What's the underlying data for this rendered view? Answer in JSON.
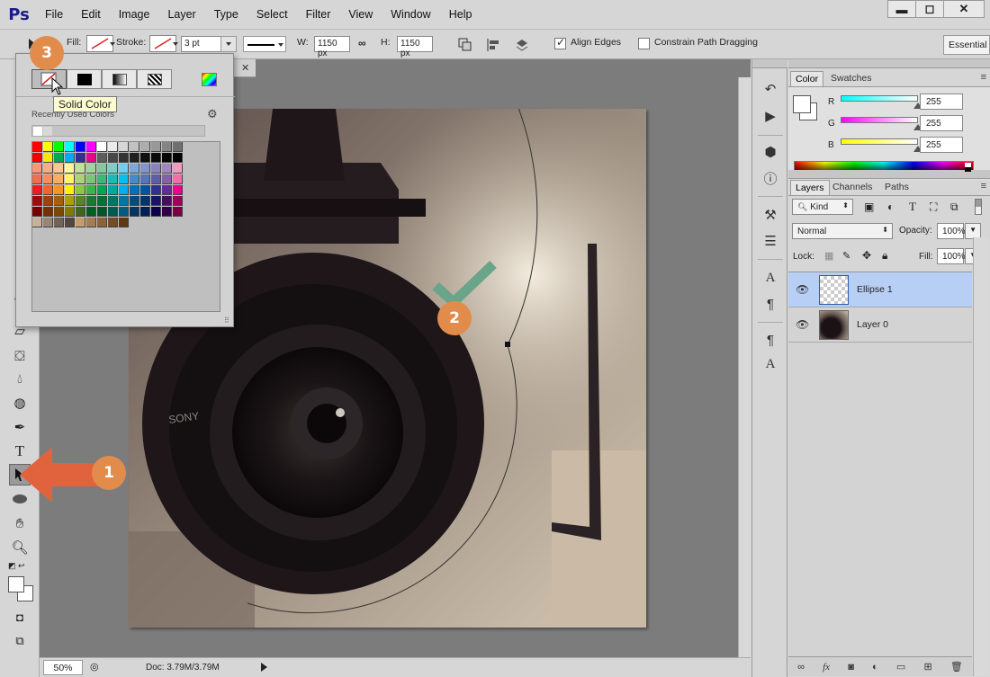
{
  "app": {
    "logo": "Ps"
  },
  "menu": [
    "File",
    "Edit",
    "Image",
    "Layer",
    "Type",
    "Select",
    "Filter",
    "View",
    "Window",
    "Help"
  ],
  "window_controls": {
    "minimize": "▬",
    "maximize": "◻",
    "close": "✕"
  },
  "options": {
    "fill_label": "Fill:",
    "stroke_label": "Stroke:",
    "stroke_width": "3 pt",
    "w_label": "W:",
    "w_value": "1150 px",
    "h_label": "H:",
    "h_value": "1150 px",
    "align_edges": "Align Edges",
    "align_edges_checked": true,
    "constrain": "Constrain Path Dragging",
    "constrain_checked": false,
    "workspace": "Essential"
  },
  "popup": {
    "tooltip": "Solid Color",
    "recent_label": "Recently Used Colors",
    "swatch_rows": [
      [
        "#ff0000",
        "#ffff00",
        "#00ff00",
        "#00ffff",
        "#0000ff",
        "#ff00ff",
        "#ffffff",
        "#ebebeb",
        "#d6d6d6",
        "#c2c2c2",
        "#adadad",
        "#999999",
        "#858585",
        "#707070"
      ],
      [
        "#f20000",
        "#f7ec00",
        "#00a651",
        "#00aeef",
        "#2e3192",
        "#ec008c",
        "#5c5c5c",
        "#474747",
        "#333333",
        "#1f1f1f",
        "#0f0f0f",
        "#0a0a0a",
        "#050505",
        "#000000"
      ],
      [
        "#f7977a",
        "#f9ad81",
        "#fdc68a",
        "#fff79a",
        "#c4df9b",
        "#a2d39c",
        "#82ca9d",
        "#7bcdc8",
        "#6ecff6",
        "#7ea7d8",
        "#8493ca",
        "#8882be",
        "#a187be",
        "#f49ac2"
      ],
      [
        "#f26c4f",
        "#f68e55",
        "#fbaf5c",
        "#fff467",
        "#acd372",
        "#7cc576",
        "#3bb878",
        "#1abbb4",
        "#00bff3",
        "#438ccb",
        "#5574b9",
        "#605ca8",
        "#855fa8",
        "#f06ea9"
      ],
      [
        "#ed1c24",
        "#f26522",
        "#f7941d",
        "#fff200",
        "#8dc73f",
        "#39b54a",
        "#00a651",
        "#00a99d",
        "#00aeef",
        "#0072bc",
        "#0054a5",
        "#2e3192",
        "#662d91",
        "#ec008c"
      ],
      [
        "#9e0b0f",
        "#a0410d",
        "#a36209",
        "#aba000",
        "#598527",
        "#1a7b30",
        "#007236",
        "#00746b",
        "#0076a3",
        "#004b80",
        "#003471",
        "#1b1464",
        "#440e62",
        "#9e005d"
      ],
      [
        "#790000",
        "#7b2e00",
        "#7d4900",
        "#827b00",
        "#406618",
        "#005e20",
        "#005826",
        "#005952",
        "#005b7f",
        "#003663",
        "#002157",
        "#0d004c",
        "#32004b",
        "#7b0046"
      ],
      [
        "#c7b299",
        "#998675",
        "#736357",
        "#534741",
        "#c69c6d",
        "#a67c52",
        "#8c6239",
        "#754c24",
        "#603913"
      ]
    ]
  },
  "status": {
    "zoom": "50%",
    "doc": "Doc: 3.79M/3.79M"
  },
  "callouts": [
    "1",
    "2",
    "3"
  ],
  "color_panel": {
    "tabs": [
      "Color",
      "Swatches"
    ],
    "sliders": [
      {
        "label": "R",
        "value": "255"
      },
      {
        "label": "G",
        "value": "255"
      },
      {
        "label": "B",
        "value": "255"
      }
    ]
  },
  "layers_panel": {
    "tabs": [
      "Layers",
      "Channels",
      "Paths"
    ],
    "filter": "Kind",
    "blend_mode": "Normal",
    "opacity_label": "Opacity:",
    "opacity": "100%",
    "lock_label": "Lock:",
    "fill_label": "Fill:",
    "fill": "100%",
    "layers": [
      {
        "name": "Ellipse 1",
        "selected": true
      },
      {
        "name": "Layer 0",
        "selected": false
      }
    ]
  }
}
